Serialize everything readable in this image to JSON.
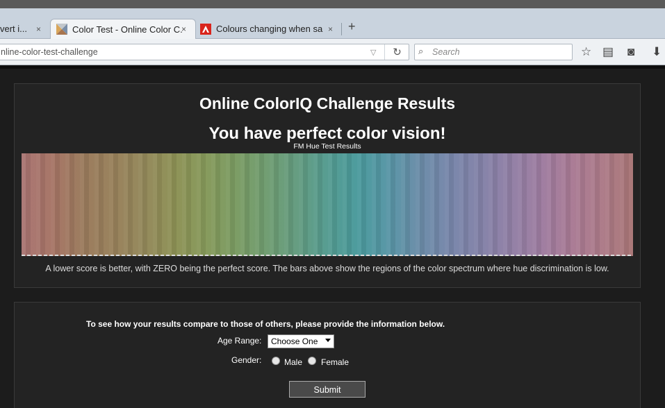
{
  "browser": {
    "tabs": [
      {
        "label": "vert i...",
        "close": "×"
      },
      {
        "label": "Color Test - Online Color C...",
        "close": "×"
      },
      {
        "label": "Colours changing when sa...",
        "close": "×"
      }
    ],
    "new_tab": "+",
    "url": "nline-color-test-challenge",
    "search_placeholder": "Search"
  },
  "icons": {
    "dropdown": "▽",
    "reload": "↻",
    "search": "⌕",
    "bookmark": "☆",
    "reading_list": "▤",
    "pocket": "◙",
    "download": "⬇"
  },
  "results": {
    "title": "Online ColorIQ Challenge Results",
    "verdict": "You have perfect color vision!",
    "chart_title": "FM Hue Test Results",
    "explanation": "A lower score is better, with ZERO being the perfect score. The bars above show the regions of the color spectrum where hue discrimination is low."
  },
  "form": {
    "intro": "To see how your results compare to those of others, please provide the information below.",
    "age_label": "Age Range:",
    "age_value": "Choose One",
    "gender_label": "Gender:",
    "gender_options": [
      "Male",
      "Female"
    ],
    "submit_label": "Submit"
  },
  "colors": {
    "page_bg": "#1c1c1c",
    "panel_bg": "#232323",
    "text": "#ffffff"
  }
}
